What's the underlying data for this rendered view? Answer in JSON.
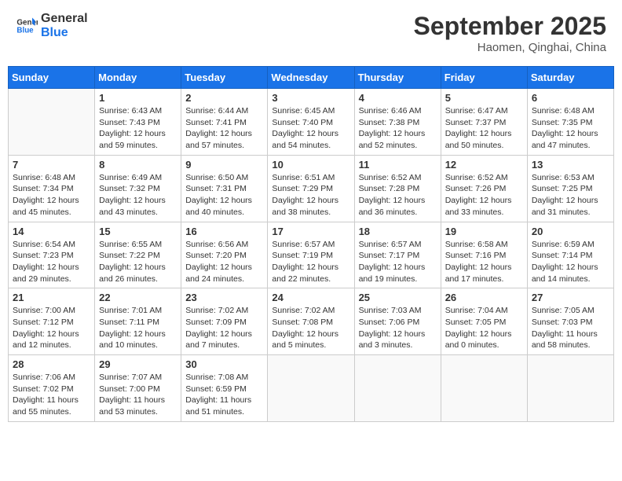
{
  "header": {
    "logo_line1": "General",
    "logo_line2": "Blue",
    "month": "September 2025",
    "location": "Haomen, Qinghai, China"
  },
  "weekdays": [
    "Sunday",
    "Monday",
    "Tuesday",
    "Wednesday",
    "Thursday",
    "Friday",
    "Saturday"
  ],
  "weeks": [
    [
      {
        "day": "",
        "info": ""
      },
      {
        "day": "1",
        "info": "Sunrise: 6:43 AM\nSunset: 7:43 PM\nDaylight: 12 hours\nand 59 minutes."
      },
      {
        "day": "2",
        "info": "Sunrise: 6:44 AM\nSunset: 7:41 PM\nDaylight: 12 hours\nand 57 minutes."
      },
      {
        "day": "3",
        "info": "Sunrise: 6:45 AM\nSunset: 7:40 PM\nDaylight: 12 hours\nand 54 minutes."
      },
      {
        "day": "4",
        "info": "Sunrise: 6:46 AM\nSunset: 7:38 PM\nDaylight: 12 hours\nand 52 minutes."
      },
      {
        "day": "5",
        "info": "Sunrise: 6:47 AM\nSunset: 7:37 PM\nDaylight: 12 hours\nand 50 minutes."
      },
      {
        "day": "6",
        "info": "Sunrise: 6:48 AM\nSunset: 7:35 PM\nDaylight: 12 hours\nand 47 minutes."
      }
    ],
    [
      {
        "day": "7",
        "info": "Sunrise: 6:48 AM\nSunset: 7:34 PM\nDaylight: 12 hours\nand 45 minutes."
      },
      {
        "day": "8",
        "info": "Sunrise: 6:49 AM\nSunset: 7:32 PM\nDaylight: 12 hours\nand 43 minutes."
      },
      {
        "day": "9",
        "info": "Sunrise: 6:50 AM\nSunset: 7:31 PM\nDaylight: 12 hours\nand 40 minutes."
      },
      {
        "day": "10",
        "info": "Sunrise: 6:51 AM\nSunset: 7:29 PM\nDaylight: 12 hours\nand 38 minutes."
      },
      {
        "day": "11",
        "info": "Sunrise: 6:52 AM\nSunset: 7:28 PM\nDaylight: 12 hours\nand 36 minutes."
      },
      {
        "day": "12",
        "info": "Sunrise: 6:52 AM\nSunset: 7:26 PM\nDaylight: 12 hours\nand 33 minutes."
      },
      {
        "day": "13",
        "info": "Sunrise: 6:53 AM\nSunset: 7:25 PM\nDaylight: 12 hours\nand 31 minutes."
      }
    ],
    [
      {
        "day": "14",
        "info": "Sunrise: 6:54 AM\nSunset: 7:23 PM\nDaylight: 12 hours\nand 29 minutes."
      },
      {
        "day": "15",
        "info": "Sunrise: 6:55 AM\nSunset: 7:22 PM\nDaylight: 12 hours\nand 26 minutes."
      },
      {
        "day": "16",
        "info": "Sunrise: 6:56 AM\nSunset: 7:20 PM\nDaylight: 12 hours\nand 24 minutes."
      },
      {
        "day": "17",
        "info": "Sunrise: 6:57 AM\nSunset: 7:19 PM\nDaylight: 12 hours\nand 22 minutes."
      },
      {
        "day": "18",
        "info": "Sunrise: 6:57 AM\nSunset: 7:17 PM\nDaylight: 12 hours\nand 19 minutes."
      },
      {
        "day": "19",
        "info": "Sunrise: 6:58 AM\nSunset: 7:16 PM\nDaylight: 12 hours\nand 17 minutes."
      },
      {
        "day": "20",
        "info": "Sunrise: 6:59 AM\nSunset: 7:14 PM\nDaylight: 12 hours\nand 14 minutes."
      }
    ],
    [
      {
        "day": "21",
        "info": "Sunrise: 7:00 AM\nSunset: 7:12 PM\nDaylight: 12 hours\nand 12 minutes."
      },
      {
        "day": "22",
        "info": "Sunrise: 7:01 AM\nSunset: 7:11 PM\nDaylight: 12 hours\nand 10 minutes."
      },
      {
        "day": "23",
        "info": "Sunrise: 7:02 AM\nSunset: 7:09 PM\nDaylight: 12 hours\nand 7 minutes."
      },
      {
        "day": "24",
        "info": "Sunrise: 7:02 AM\nSunset: 7:08 PM\nDaylight: 12 hours\nand 5 minutes."
      },
      {
        "day": "25",
        "info": "Sunrise: 7:03 AM\nSunset: 7:06 PM\nDaylight: 12 hours\nand 3 minutes."
      },
      {
        "day": "26",
        "info": "Sunrise: 7:04 AM\nSunset: 7:05 PM\nDaylight: 12 hours\nand 0 minutes."
      },
      {
        "day": "27",
        "info": "Sunrise: 7:05 AM\nSunset: 7:03 PM\nDaylight: 11 hours\nand 58 minutes."
      }
    ],
    [
      {
        "day": "28",
        "info": "Sunrise: 7:06 AM\nSunset: 7:02 PM\nDaylight: 11 hours\nand 55 minutes."
      },
      {
        "day": "29",
        "info": "Sunrise: 7:07 AM\nSunset: 7:00 PM\nDaylight: 11 hours\nand 53 minutes."
      },
      {
        "day": "30",
        "info": "Sunrise: 7:08 AM\nSunset: 6:59 PM\nDaylight: 11 hours\nand 51 minutes."
      },
      {
        "day": "",
        "info": ""
      },
      {
        "day": "",
        "info": ""
      },
      {
        "day": "",
        "info": ""
      },
      {
        "day": "",
        "info": ""
      }
    ]
  ]
}
